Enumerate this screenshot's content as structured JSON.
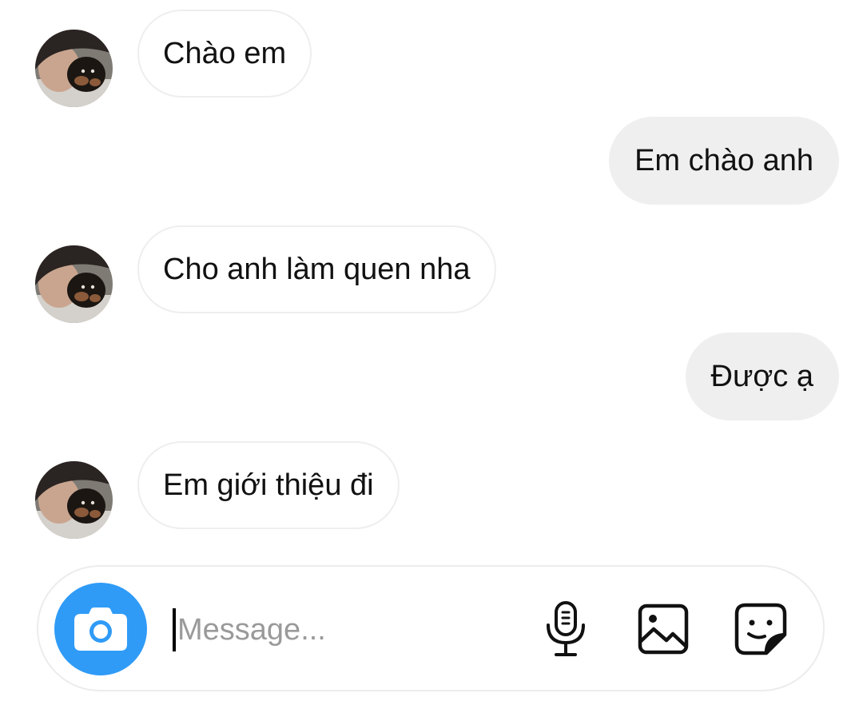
{
  "conversation": {
    "messages": [
      {
        "sender": "other",
        "text": "Chào em"
      },
      {
        "sender": "me",
        "text": "Em chào anh"
      },
      {
        "sender": "other",
        "text": "Cho anh làm quen nha"
      },
      {
        "sender": "me",
        "text": "Được ạ"
      },
      {
        "sender": "other",
        "text": "Em giới thiệu đi"
      }
    ]
  },
  "composer": {
    "input_value": "",
    "placeholder": "Message...",
    "camera_icon": "camera-icon",
    "tools": [
      "microphone-icon",
      "gallery-icon",
      "sticker-icon"
    ]
  },
  "colors": {
    "accent": "#2f9bf7",
    "incoming_bubble_border": "#eeeeee",
    "outgoing_bubble_bg": "#efefef",
    "placeholder": "#9a9a9a"
  }
}
